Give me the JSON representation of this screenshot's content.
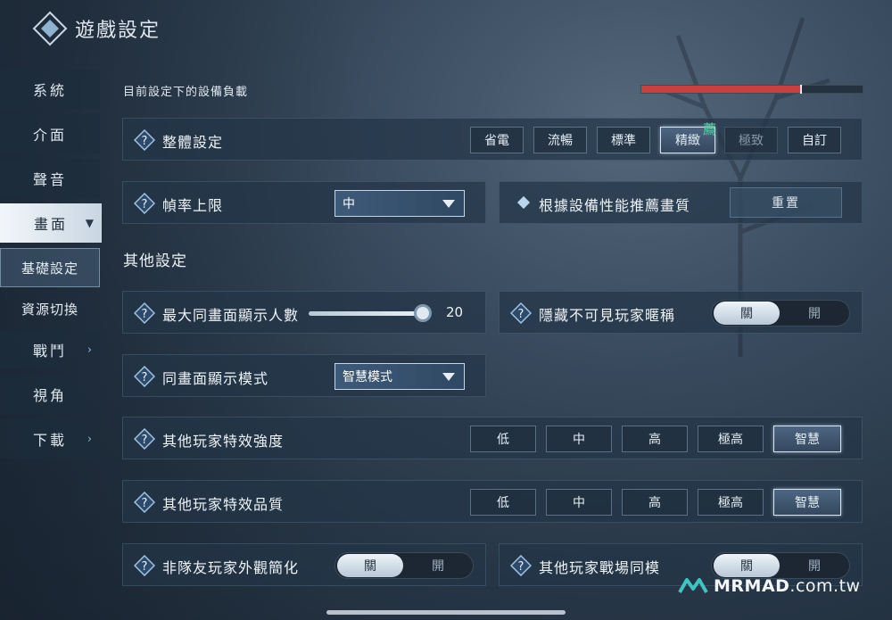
{
  "header": {
    "title": "遊戲設定"
  },
  "sidebar": {
    "items": [
      {
        "label": "系統",
        "chevron": false
      },
      {
        "label": "介面",
        "chevron": false
      },
      {
        "label": "聲音",
        "chevron": false
      },
      {
        "label": "畫面",
        "chevron": true,
        "active": true
      }
    ],
    "subitems": [
      {
        "label": "基礎設定",
        "active": true
      },
      {
        "label": "資源切換",
        "active": false
      }
    ],
    "more_items": [
      {
        "label": "戰鬥",
        "chevron": true
      },
      {
        "label": "視角",
        "chevron": false
      },
      {
        "label": "下載",
        "chevron": true
      }
    ]
  },
  "device_load": {
    "label": "目前設定下的設備負載",
    "level_percent": 72,
    "fill_color": "#c9403f"
  },
  "overall": {
    "label": "整體設定",
    "options": [
      "省電",
      "流暢",
      "標準",
      "精緻",
      "極致",
      "自訂"
    ],
    "selected": "精緻",
    "disabled": [
      "極致"
    ],
    "recommend_tag": "薦"
  },
  "frame_rate": {
    "label": "幀率上限",
    "value": "中"
  },
  "recommend": {
    "label": "根據設備性能推薦畫質",
    "button": "重置"
  },
  "other_section": {
    "title": "其他設定"
  },
  "max_players": {
    "label": "最大同畫面顯示人數",
    "value": "20",
    "slider_level_percent": 100
  },
  "hide_names": {
    "label": "隱藏不可見玩家暱稱",
    "on": "關",
    "off": "開",
    "state": "關"
  },
  "display_mode": {
    "label": "同畫面顯示模式",
    "value": "智慧模式"
  },
  "effect_intensity": {
    "label": "其他玩家特效強度",
    "options": [
      "低",
      "中",
      "高",
      "極高",
      "智慧"
    ],
    "selected": "智慧"
  },
  "effect_quality": {
    "label": "其他玩家特效品質",
    "options": [
      "低",
      "中",
      "高",
      "極高",
      "智慧"
    ],
    "selected": "智慧"
  },
  "simplify_appearance": {
    "label": "非隊友玩家外觀簡化",
    "on": "關",
    "off": "開",
    "state": "關"
  },
  "battlefield_model": {
    "label": "其他玩家戰場同模",
    "on": "關",
    "off": "開",
    "state": "關"
  },
  "watermark": {
    "brand": "MRMAD",
    "domain": ".com.tw"
  },
  "icons": {
    "help": "question-icon",
    "chevron": "chevron-right-icon",
    "caret": "caret-down-icon"
  }
}
